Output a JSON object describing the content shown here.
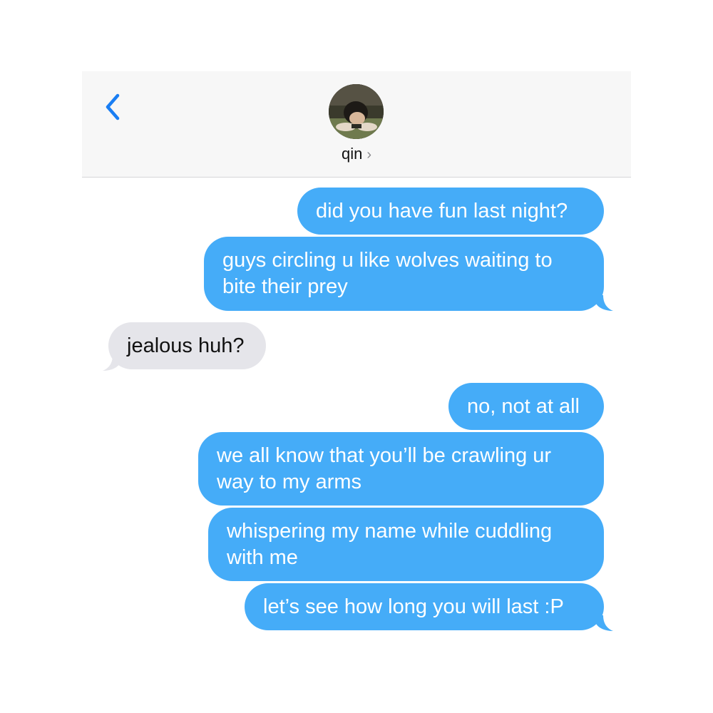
{
  "header": {
    "back_icon": "chevron-left-icon",
    "contact_name": "qin",
    "contact_chevron": "›",
    "accent_color": "#1a7ef3"
  },
  "messages": [
    {
      "direction": "sent",
      "text": "did you have fun last night?"
    },
    {
      "direction": "sent",
      "text": "guys circling u like wolves waiting to bite their prey"
    },
    {
      "direction": "received",
      "text": "jealous huh?"
    },
    {
      "direction": "sent",
      "text": "no, not at all"
    },
    {
      "direction": "sent",
      "text": "we all know that you’ll be crawling ur way to my arms"
    },
    {
      "direction": "sent",
      "text": "whispering my name while cuddling with me"
    },
    {
      "direction": "sent",
      "text": "let’s see how long you will last :P"
    }
  ],
  "colors": {
    "sent_bubble": "#45acf8",
    "received_bubble": "#e5e5ea",
    "header_bg": "#f7f7f7"
  }
}
